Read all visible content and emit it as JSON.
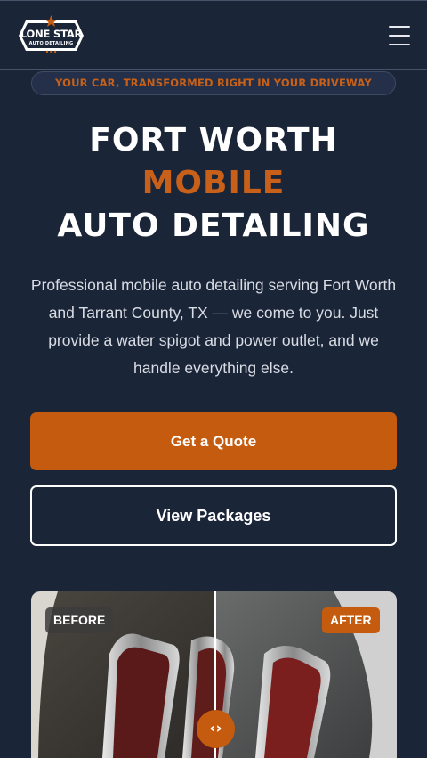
{
  "header": {
    "logo_title": "LONE STAR",
    "logo_sub": "AUTO DETAILING",
    "menu_icon": "hamburger-menu-icon"
  },
  "hero": {
    "tagline": "YOUR CAR, TRANSFORMED RIGHT IN YOUR DRIVEWAY",
    "title_line1": "FORT WORTH",
    "title_line2": "MOBILE",
    "title_line3": "AUTO DETAILING",
    "description": "Professional mobile auto detailing serving Fort Worth and Tarrant County, TX — we come to you. Just provide a water spigot and power outlet, and we handle everything else.",
    "primary_button": "Get a Quote",
    "secondary_button": "View Packages"
  },
  "comparison": {
    "before_label": "BEFORE",
    "after_label": "AFTER",
    "handle_icon": "compare-arrows-icon",
    "handle_glyph": "‹›",
    "split": 0.5
  },
  "colors": {
    "background": "#1b2538",
    "accent": "#c55b0e",
    "text": "#ffffff"
  }
}
